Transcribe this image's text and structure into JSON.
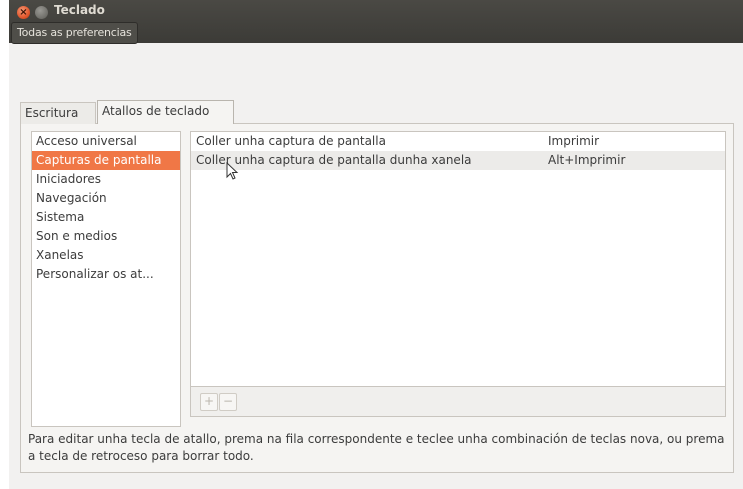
{
  "window": {
    "title": "Teclado"
  },
  "toolbar": {
    "all_prefs_label": "Todas as preferencias"
  },
  "tabs": [
    {
      "label": "Escritura"
    },
    {
      "label": "Atallos de teclado"
    }
  ],
  "categories": [
    {
      "label": "Acceso universal"
    },
    {
      "label": "Capturas de pantalla"
    },
    {
      "label": "Iniciadores"
    },
    {
      "label": "Navegación"
    },
    {
      "label": "Sistema"
    },
    {
      "label": "Son e medios"
    },
    {
      "label": "Xanelas"
    },
    {
      "label": "Personalizar os at..."
    }
  ],
  "shortcuts": [
    {
      "action": "Coller unha captura de pantalla",
      "key": "Imprimir"
    },
    {
      "action": "Coller unha captura de pantalla dunha xanela",
      "key": "Alt+Imprimir"
    }
  ],
  "buttons": {
    "add": "+",
    "remove": "−"
  },
  "help_text": "Para editar unha tecla de atallo, prema na fila correspondente e teclee unha combinación de teclas nova, ou prema a tecla de retroceso para borrar todo.",
  "colors": {
    "selection": "#f07746",
    "titlebar": "#3c3b37",
    "close_button": "#e2572c"
  },
  "icons": {
    "close": "close-icon",
    "minimize": "minimize-icon",
    "cursor": "mouse-pointer-icon"
  }
}
